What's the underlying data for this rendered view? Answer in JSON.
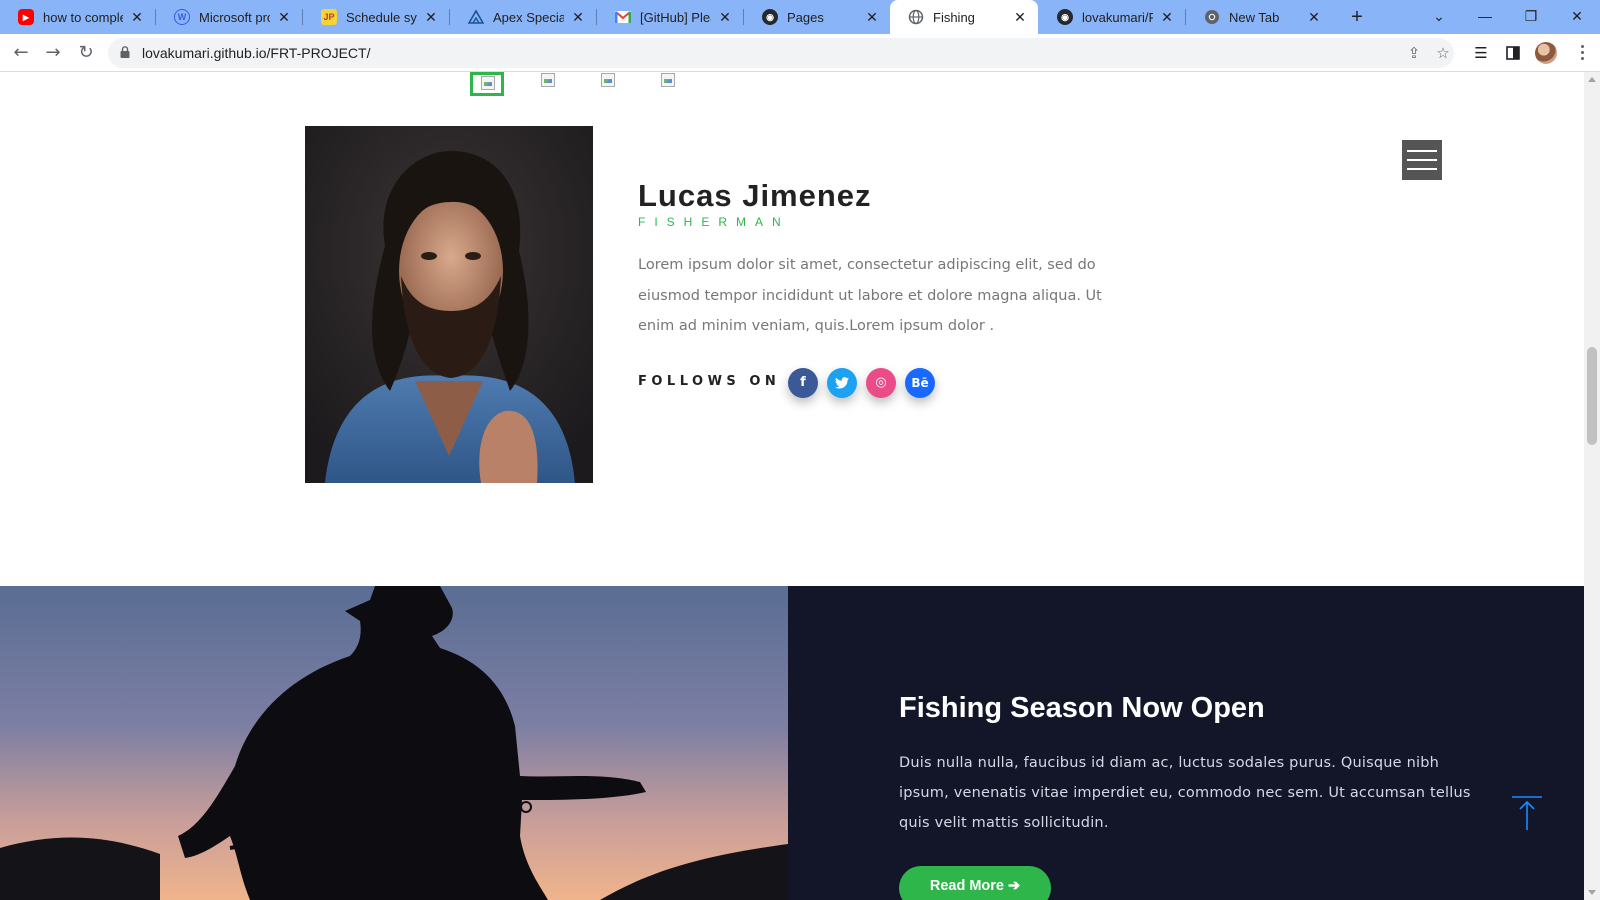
{
  "browser": {
    "tabs": [
      {
        "title": "how to complete",
        "favicon": "youtube-icon",
        "color": "#ff0000"
      },
      {
        "title": "Microsoft proje",
        "favicon": "wordpress-icon",
        "color": "#3858e9"
      },
      {
        "title": "Schedule synch",
        "favicon": "jp-icon",
        "color": "#f6d338"
      },
      {
        "title": "Apex Specialist",
        "favicon": "trailhead-icon",
        "color": "#1b5297"
      },
      {
        "title": "[GitHub] Please",
        "favicon": "gmail-icon",
        "color": "#ea4335"
      },
      {
        "title": "Pages",
        "favicon": "github-icon",
        "color": "#24292f"
      },
      {
        "title": "Fishing",
        "favicon": "globe-icon",
        "color": "#5f6368"
      },
      {
        "title": "lovakumari/FRT",
        "favicon": "github-icon",
        "color": "#24292f"
      },
      {
        "title": "New Tab",
        "favicon": "chrome-icon",
        "color": "#5f6368"
      }
    ],
    "url": "lovakumari.github.io/FRT-PROJECT/"
  },
  "profile": {
    "name": "Lucas Jimenez",
    "role": "FISHERMAN",
    "bio": "Lorem ipsum dolor sit amet, consectetur adipiscing elit, sed do eiusmod tempor incididunt ut labore et dolore magna aliqua. Ut enim ad minim veniam, quis.Lorem ipsum dolor .",
    "follows_label": "FOLLOWS ON",
    "social": [
      {
        "name": "facebook",
        "glyph": "f",
        "color": "#3b5998"
      },
      {
        "name": "twitter",
        "glyph": "t",
        "color": "#1da1f2"
      },
      {
        "name": "dribbble",
        "glyph": "◎",
        "color": "#ea4c89"
      },
      {
        "name": "behance",
        "glyph": "Bē",
        "color": "#1769ff"
      }
    ]
  },
  "hero": {
    "title": "Fishing Season Now Open",
    "body": "Duis nulla nulla, faucibus id diam ac, luctus sodales purus. Quisque nibh ipsum, venenatis vitae imperdiet eu, commodo nec sem. Ut accumsan tellus quis velit mattis sollicitudin.",
    "button": "Read More ➔"
  },
  "colors": {
    "accent": "#2eb64a",
    "dark_panel": "#121628",
    "totop": "#1a8cff"
  }
}
